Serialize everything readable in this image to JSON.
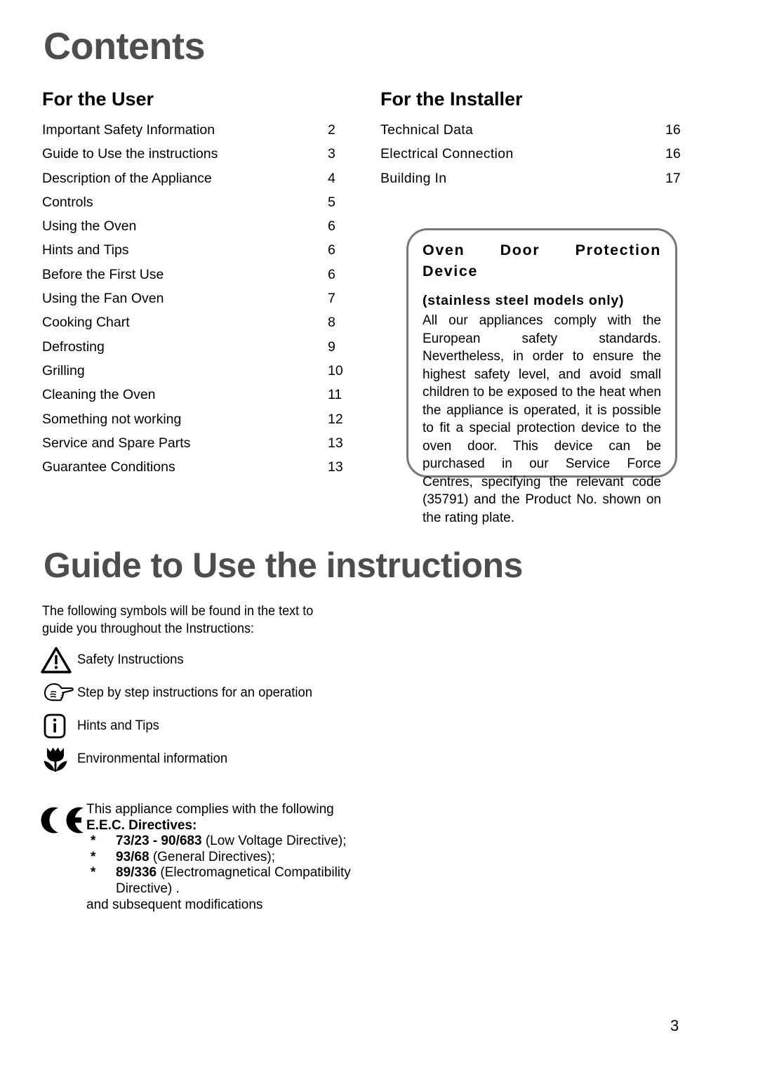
{
  "document": {
    "page_number": "3"
  },
  "contents": {
    "title": "Contents",
    "user": {
      "heading": "For the User",
      "entries": [
        {
          "label": "Important Safety Information",
          "page": "2"
        },
        {
          "label": "Guide to Use the instructions",
          "page": "3"
        },
        {
          "label": "Description of the Appliance",
          "page": "4"
        },
        {
          "label": "Controls",
          "page": "5"
        },
        {
          "label": "Using the Oven",
          "page": "6"
        },
        {
          "label": "Hints and Tips",
          "page": "6"
        },
        {
          "label": "Before the First Use",
          "page": "6"
        },
        {
          "label": "Using the Fan Oven",
          "page": "7"
        },
        {
          "label": "Cooking Chart",
          "page": "8"
        },
        {
          "label": "Defrosting",
          "page": "9"
        },
        {
          "label": "Grilling",
          "page": "10"
        },
        {
          "label": "Cleaning the Oven",
          "page": "11"
        },
        {
          "label": "Something not working",
          "page": "12"
        },
        {
          "label": "Service and Spare Parts",
          "page": "13"
        },
        {
          "label": "Guarantee Conditions",
          "page": "13"
        }
      ]
    },
    "installer": {
      "heading": "For the Installer",
      "entries": [
        {
          "label": "Technical Data",
          "page": "16"
        },
        {
          "label": "Electrical Connection",
          "page": "16"
        },
        {
          "label": "Building In",
          "page": "17"
        }
      ]
    }
  },
  "protection_box": {
    "title_line1": "Oven Door Protection",
    "title_line2": "Device",
    "subtitle": "(stainless steel models only)",
    "body": "All our appliances comply with the European safety standards. Nevertheless, in order to ensure the highest safety level, and avoid small children to be exposed to the heat when the appliance is operated, it is possible to fit a special protection device to the oven door. This device can be purchased in our Service Force Centres, specifying the relevant code (35791) and the Product No. shown on the rating plate.",
    "border_color": "#787878"
  },
  "guide": {
    "title": "Guide to Use the instructions",
    "intro": "The following symbols will be found in the text to guide you throughout the Instructions:",
    "symbols": [
      {
        "icon": "warning-triangle-icon",
        "label": "Safety Instructions"
      },
      {
        "icon": "pointing-hand-icon",
        "label": "Step by step instructions for an operation"
      },
      {
        "icon": "info-icon",
        "label": "Hints and Tips"
      },
      {
        "icon": "tulip-icon",
        "label": "Environmental information"
      }
    ]
  },
  "ce": {
    "mark": "CE",
    "intro": "This appliance complies with the following",
    "heading": "E.E.C. Directives:",
    "directives": [
      {
        "star": "*",
        "code": "73/23 - 90/683",
        "desc": "(Low Voltage Directive);"
      },
      {
        "star": "*",
        "code": "93/68",
        "desc": "(General Directives);"
      },
      {
        "star": "*",
        "code": "89/336",
        "desc": "(Electromagnetical Compatibility"
      }
    ],
    "directive_continuation": "Directive) .",
    "footer": "and subsequent modifications"
  },
  "colors": {
    "title_gray": "#4d4d4d",
    "text_black": "#000000",
    "box_border": "#787878",
    "page_background": "#ffffff"
  }
}
